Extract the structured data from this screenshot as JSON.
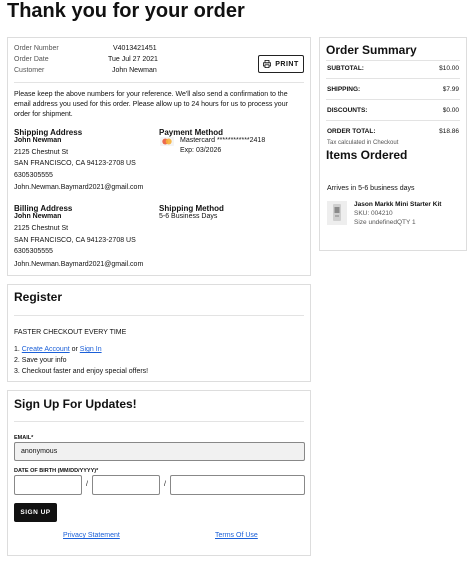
{
  "page_title": "Thank you for your order",
  "order_info": {
    "number_label": "Order Number",
    "number_value": "V4013421451",
    "date_label": "Order Date",
    "date_value": "Tue Jul 27 2021",
    "customer_label": "Customer",
    "customer_value": "John Newman"
  },
  "print_label": "PRINT",
  "notice": "Please keep the above numbers for your reference. We'll also send a confirmation to the email address you used for this order. Please allow up to 24 hours for us to process your order for shipment.",
  "shipping_address": {
    "heading": "Shipping Address",
    "name": "John Newman",
    "street": "2125 Chestnut St",
    "city": "SAN FRANCISCO, CA 94123-2708 US",
    "phone": "6305305555",
    "email": "John.Newman.Baymard2021@gmail.com"
  },
  "payment_method": {
    "heading": "Payment Method",
    "card": "Mastercard ************2418",
    "exp": "Exp: 03/2026",
    "card_icon": "mastercard-icon"
  },
  "billing_address": {
    "heading": "Billing Address",
    "name": "John Newman",
    "street": "2125 Chestnut St",
    "city": "SAN FRANCISCO, CA 94123-2708 US",
    "phone": "6305305555",
    "email": "John.Newman.Baymard2021@gmail.com"
  },
  "shipping_method": {
    "heading": "Shipping Method",
    "value": "5-6 Business Days"
  },
  "register": {
    "heading": "Register",
    "tagline": "FASTER CHECKOUT EVERY TIME",
    "step1_prefix": "1. ",
    "create_account": "Create Account",
    "or": " or ",
    "sign_in": "Sign In",
    "step2": "2. Save your info",
    "step3": "3. Checkout faster and enjoy special offers!"
  },
  "signup": {
    "heading": "Sign Up For Updates!",
    "email_label": "EMAIL*",
    "email_value": "anonymous",
    "dob_label": "DATE OF BIRTH (MM/DD/YYYY)*",
    "slash": "/",
    "button": "SIGN UP",
    "privacy": "Privacy Statement",
    "terms": "Terms Of Use"
  },
  "summary": {
    "heading": "Order Summary",
    "subtotal_label": "SUBTOTAL:",
    "subtotal_value": "$10.00",
    "shipping_label": "SHIPPING:",
    "shipping_value": "$7.99",
    "discounts_label": "DISCOUNTS:",
    "discounts_value": "$0.00",
    "total_label": "ORDER TOTAL:",
    "total_value": "$18.86",
    "tax_note": "Tax calculated in Checkout",
    "items_heading": "Items Ordered",
    "arrives": "Arrives in 5-6 business days",
    "item_name": "Jason Markk Mini Starter Kit",
    "item_sku": "SKU: 004210",
    "item_meta": "Size undefinedQTY 1"
  },
  "colors": {
    "link": "#1a5fd8",
    "button_bg": "#111111",
    "border": "#dddddd"
  }
}
